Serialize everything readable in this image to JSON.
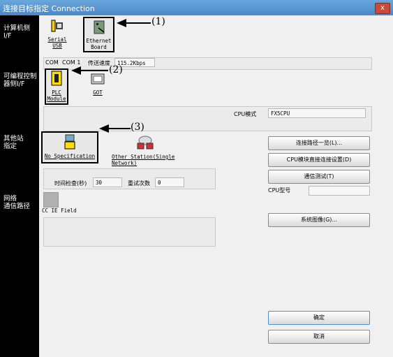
{
  "window": {
    "title": "连接目标指定 Connection",
    "close": "x"
  },
  "sidebar": {
    "pc_if": "计算机侧\nI/F",
    "plc_if": "可编程控制\n器侧I/F",
    "other_station": "其他站\n指定",
    "network_route": "网络\n通信路径"
  },
  "pc_side": {
    "serial_label": "Serial\nUSB",
    "ethernet_label": "Ethernet\nBoard",
    "com_label": "COM",
    "com_value": "COM 1",
    "speed_label": "传送速度",
    "speed_value": "115.2Kbps"
  },
  "plc_side": {
    "plc_module_label": "PLC\nModule",
    "got_label": "GOT",
    "cpu_mode_label": "CPU模式",
    "cpu_mode_value": "FX5CPU"
  },
  "other_station": {
    "no_spec_label": "No Specification",
    "other_single_label": "Other Station(Single\nNetwork)",
    "timeout_label": "时间检查(秒)",
    "timeout_value": "30",
    "retry_label": "重试次数",
    "retry_value": "0"
  },
  "network": {
    "cc_ie_label": "CC IE Field"
  },
  "buttons": {
    "connection_list": "连接路径一览(L)...",
    "cpu_direct": "CPU模块直接连接设置(D)",
    "comm_test": "通信测试(T)",
    "system_image": "系统图像(G)...",
    "ok": "确定",
    "cancel": "取消"
  },
  "cpu_type_label": "CPU型号",
  "callouts": {
    "one": "(1)",
    "two": "(2)",
    "three": "(3)"
  }
}
